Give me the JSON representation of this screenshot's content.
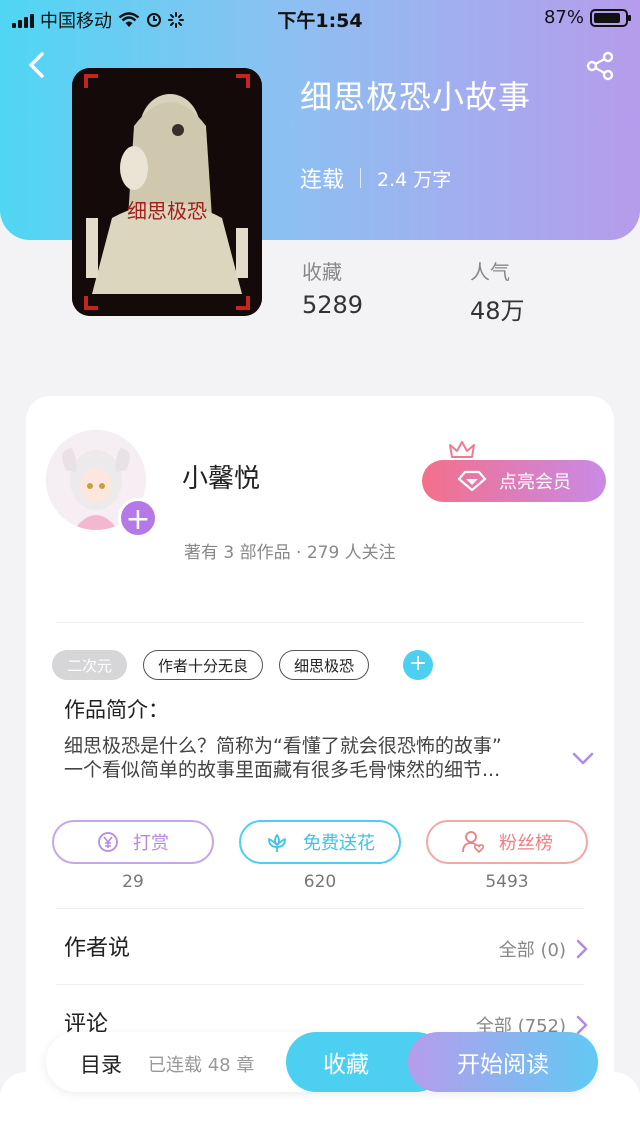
{
  "status_bar": {
    "carrier": "中国移动",
    "time": "下午1:54",
    "battery": "87%",
    "battery_level": 0.87
  },
  "book": {
    "title": "细思极恐小故事",
    "status": "连载",
    "word_count": "2.4 万字",
    "favorites_label": "收藏",
    "favorites_value": "5289",
    "popularity_label": "人气",
    "popularity_value": "48万"
  },
  "author": {
    "name": "小馨悦",
    "info": "著有 3 部作品 · 279 人关注",
    "vip_button": "点亮会员"
  },
  "tags": [
    "二次元",
    "作者十分无良",
    "细思极恐"
  ],
  "intro": {
    "label": "作品简介：",
    "text_line1": "细思极恐是什么？简称为“看懂了就会很恐怖的故事”",
    "text_line2": "一个看似简单的故事里面藏有很多毛骨悚然的细节..."
  },
  "actions": [
    {
      "label": "打赏",
      "count": "29"
    },
    {
      "label": "免费送花",
      "count": "620"
    },
    {
      "label": "粉丝榜",
      "count": "5493"
    }
  ],
  "author_say": {
    "title": "作者说",
    "link": "全部 (0)"
  },
  "comments": {
    "title": "评论",
    "link": "全部 (752)"
  },
  "bottom_bar": {
    "toc": "目录",
    "chapters": "已连载 48 章",
    "collect": "收藏",
    "read": "开始阅读"
  },
  "colors": {
    "cyan": "#4ccff0",
    "purple": "#b69cec",
    "pink": "#f46f8b"
  }
}
